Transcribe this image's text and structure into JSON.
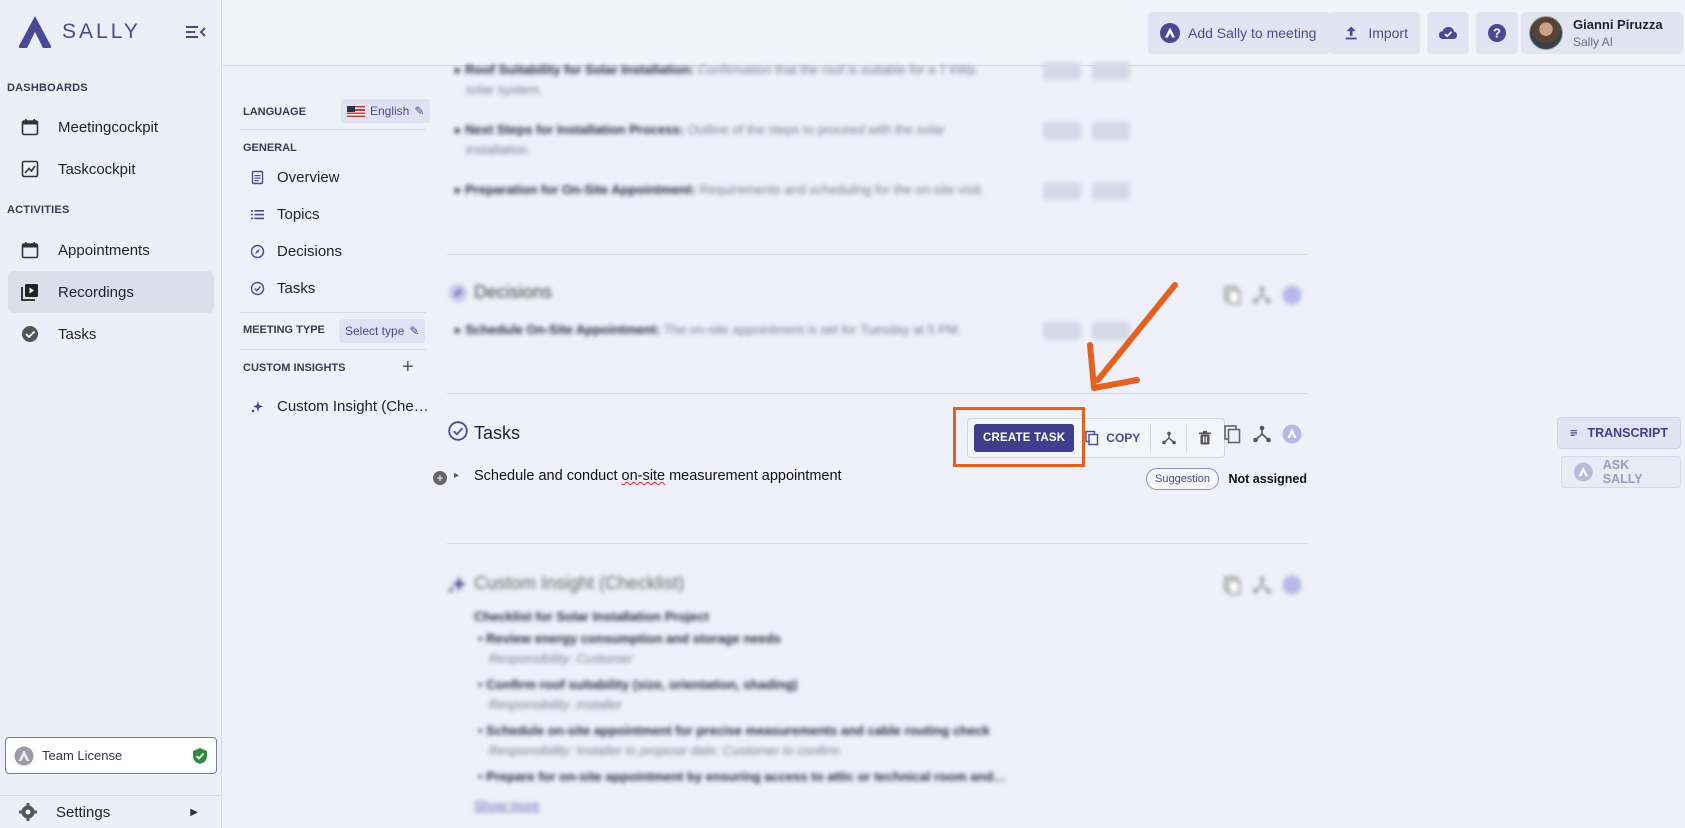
{
  "sidebar": {
    "brand": "SALLY",
    "section_dashboards": "DASHBOARDS",
    "section_activities": "ACTIVITIES",
    "items": [
      {
        "label": "Meetingcockpit",
        "icon": "calendar-icon"
      },
      {
        "label": "Taskcockpit",
        "icon": "chart-icon"
      },
      {
        "label": "Appointments",
        "icon": "calendar-icon"
      },
      {
        "label": "Recordings",
        "icon": "play-library-icon",
        "active": true
      },
      {
        "label": "Tasks",
        "icon": "check-circle-icon"
      }
    ],
    "license": "Team License",
    "settings": "Settings"
  },
  "topbar": {
    "add_sally": "Add Sally to meeting",
    "import": "Import",
    "user_name": "Gianni Piruzza",
    "user_org": "Sally AI"
  },
  "innernav": {
    "language_label": "LANGUAGE",
    "language_value": "English",
    "general_label": "GENERAL",
    "items": [
      "Overview",
      "Topics",
      "Decisions",
      "Tasks"
    ],
    "meeting_type_label": "MEETING TYPE",
    "meeting_type_value": "Select type",
    "custom_insights_label": "CUSTOM INSIGHTS",
    "custom_insight_item": "Custom Insight (Che…"
  },
  "topics_blurred": [
    {
      "title": "Roof Suitability for Solar Installation:",
      "desc": "Confirmation that the roof is suitable for a 7 kWp",
      "desc2": "solar system."
    },
    {
      "title": "Next Steps for Installation Process:",
      "desc": "Outline of the steps to proceed with the solar",
      "desc2": "installation."
    },
    {
      "title": "Preparation for On-Site Appointment:",
      "desc": "Requirements and scheduling for the on-site visit.",
      "desc2": ""
    }
  ],
  "decisions": {
    "title": "Decisions",
    "item_title": "Schedule On-Site Appointment:",
    "item_desc": "The on-site appointment is set for Tuesday at 5 PM."
  },
  "tasks": {
    "title": "Tasks",
    "create_task": "CREATE TASK",
    "copy": "COPY",
    "item_text_1": "Schedule and conduct ",
    "item_text_2": "on-site",
    "item_text_3": " measurement appointment",
    "badge": "Suggestion",
    "assignee": "Not assigned"
  },
  "custom_insight": {
    "title": "Custom Insight (Checklist)",
    "heading": "Checklist for Solar Installation Project",
    "items": [
      {
        "text": "Review energy consumption and storage needs",
        "resp": "Responsibility: Customer"
      },
      {
        "text": "Confirm roof suitability (size, orientation, shading)",
        "resp": "Responsibility: Installer"
      },
      {
        "text": "Schedule on-site appointment for precise measurements and cable routing check",
        "resp": "Responsibility: Installer to propose date; Customer to confirm"
      },
      {
        "text": "Prepare for on-site appointment by ensuring access to attic or technical room and…",
        "resp": ""
      }
    ],
    "show_more": "Show more"
  },
  "right_panel": {
    "transcript": "TRANSCRIPT",
    "ask_sally": "ASK SALLY"
  },
  "colors": {
    "accent": "#3f3e8c",
    "highlight": "#e3621f",
    "license_ok": "#2e8b3e"
  }
}
